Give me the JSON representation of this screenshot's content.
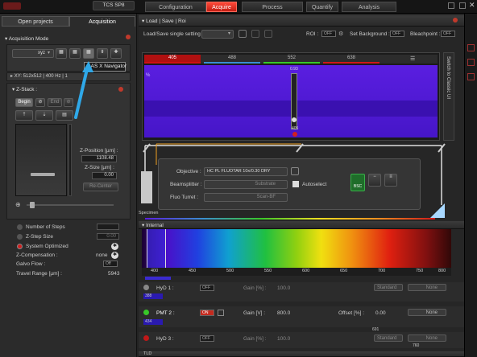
{
  "app": {
    "system": "TCS SP8"
  },
  "main_tabs": [
    {
      "label": "Configuration",
      "active": false
    },
    {
      "label": "Acquire",
      "active": true
    },
    {
      "label": "Process",
      "active": false
    },
    {
      "label": "Quantify",
      "active": false
    },
    {
      "label": "Analysis",
      "active": false
    }
  ],
  "left_tabs": {
    "open_projects": "Open projects",
    "acquisition": "Acquisition"
  },
  "acq_mode": {
    "title": "Acquisition Mode",
    "value": "xyz",
    "tooltip": "LAS X Navigator"
  },
  "xy_header": "XY: 512x512 | 400 Hz | 1",
  "zstack": {
    "title": "Z-Stack :",
    "begin": "Begin",
    "end": "End",
    "zpos_label": "Z-Position [µm] :",
    "zpos_value": "1108.48",
    "zsize_label": "Z-Size [µm] :",
    "zsize_value": "0.00",
    "recenter": "Re-Center",
    "num_steps": "Number of Steps",
    "step_size": "Z-Step Size",
    "step_size_value": "0.00",
    "optimized": "System Optimized",
    "compensation": "Z-Compensation :",
    "compensation_value": "none",
    "galvo": "Galvo Flow :",
    "galvo_value": "Off",
    "travel": "Travel Range [µm] :",
    "travel_value": "5943"
  },
  "load_save": {
    "title": "Load | Save | Roi",
    "single_setting": "Load/Save single setting :",
    "roi": "ROI :",
    "roi_toggle": "OFF",
    "set_bg": "Set Background :",
    "set_bg_toggle": "OFF",
    "bleachpoint": "Bleachpoint :",
    "bleach_toggle": "OFF"
  },
  "lasers": {
    "lines": [
      "405",
      "488",
      "552",
      "638"
    ],
    "line_colors": [
      "#d01010",
      "#3a8fd0",
      "#38c828",
      "#d01818"
    ],
    "side_label": "Switch to Classic UI",
    "percent_label": "%",
    "slider_value": "0.93",
    "slider_line": "405"
  },
  "optics": {
    "objective_label": "Objective :",
    "objective_value": "HC PL FLUOTAR   10x/0.30 DRY",
    "beamsplitter_label": "Beamsplitter :",
    "beamsplitter_value": "Substrate",
    "fluo_label": "Fluo Turret :",
    "fluo_value": "Scan-BF",
    "autoselect": "Autoselect",
    "bsc": "BSC",
    "specimen": "Specimen"
  },
  "internal": {
    "title": "Internal",
    "ticks": [
      "400",
      "450",
      "500",
      "550",
      "600",
      "650",
      "700",
      "750",
      "800"
    ]
  },
  "detectors": [
    {
      "name": "HyD 1 :",
      "toggle": "OFF",
      "gain_label": "Gain [%] :",
      "gain_value": "100.0",
      "mode": "Standard",
      "lut": "None",
      "range_lo": "388",
      "active": false
    },
    {
      "name": "PMT 2 :",
      "toggle": "ON",
      "gain_label": "Gain [V] :",
      "gain_value": "800.0",
      "offset_label": "Offset [%] :",
      "offset_value": "0.00",
      "lut": "None",
      "range_lo": "434",
      "range_hi": "691",
      "active": true
    },
    {
      "name": "HyD 3 :",
      "toggle": "OFF",
      "gain_label": "Gain [%] :",
      "gain_value": "100.0",
      "mode": "Standard",
      "lut": "None",
      "range_hi": "760",
      "active": false
    }
  ],
  "tld_label": "TLD"
}
